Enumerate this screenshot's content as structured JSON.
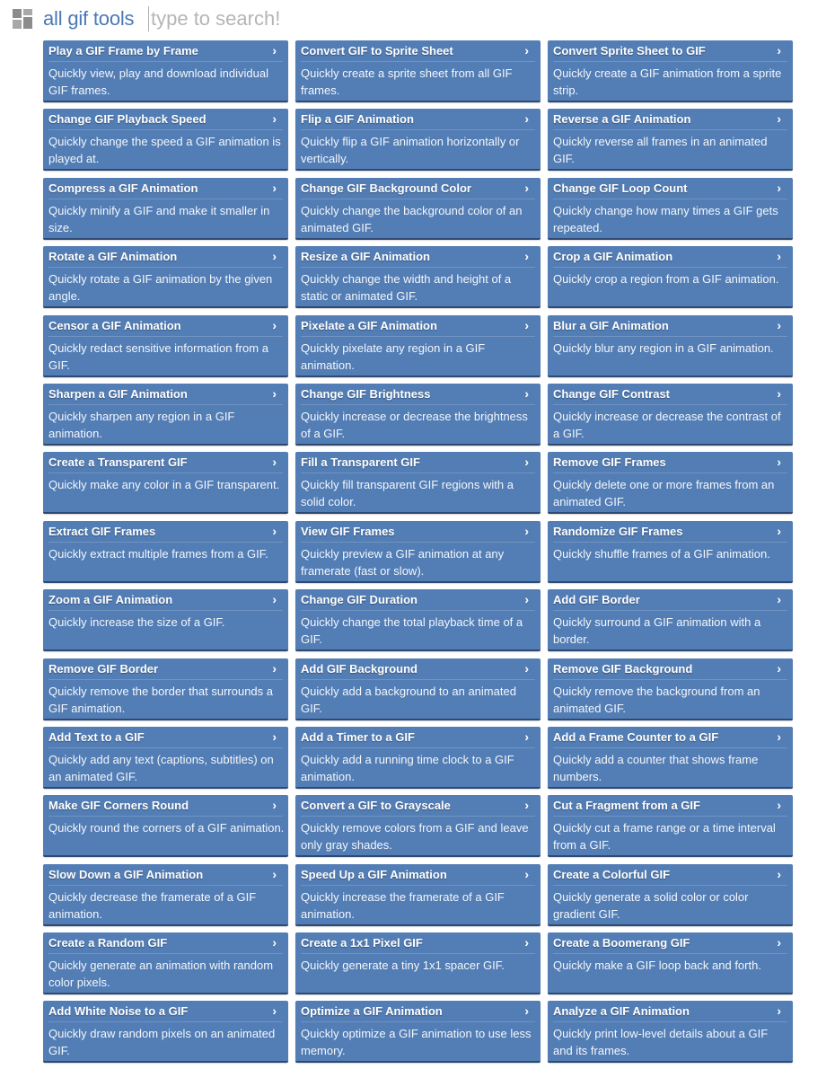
{
  "header": {
    "logo_icon": "grid-squares-icon",
    "title": "all gif tools",
    "search_placeholder": "type to search!",
    "search_value": ""
  },
  "card_icon": "chevron-right-icon",
  "tools": [
    {
      "title": "Play a GIF Frame by Frame",
      "desc": "Quickly view, play and download individual GIF frames."
    },
    {
      "title": "Convert GIF to Sprite Sheet",
      "desc": "Quickly create a sprite sheet from all GIF frames."
    },
    {
      "title": "Convert Sprite Sheet to GIF",
      "desc": "Quickly create a GIF animation from a sprite strip."
    },
    {
      "title": "Change GIF Playback Speed",
      "desc": "Quickly change the speed a GIF animation is played at."
    },
    {
      "title": "Flip a GIF Animation",
      "desc": "Quickly flip a GIF animation horizontally or vertically."
    },
    {
      "title": "Reverse a GIF Animation",
      "desc": "Quickly reverse all frames in an animated GIF."
    },
    {
      "title": "Compress a GIF Animation",
      "desc": "Quickly minify a GIF and make it smaller in size."
    },
    {
      "title": "Change GIF Background Color",
      "desc": "Quickly change the background color of an animated GIF."
    },
    {
      "title": "Change GIF Loop Count",
      "desc": "Quickly change how many times a GIF gets repeated."
    },
    {
      "title": "Rotate a GIF Animation",
      "desc": "Quickly rotate a GIF animation by the given angle."
    },
    {
      "title": "Resize a GIF Animation",
      "desc": "Quickly change the width and height of a static or animated GIF."
    },
    {
      "title": "Crop a GIF Animation",
      "desc": "Quickly crop a region from a GIF animation."
    },
    {
      "title": "Censor a GIF Animation",
      "desc": "Quickly redact sensitive information from a GIF."
    },
    {
      "title": "Pixelate a GIF Animation",
      "desc": "Quickly pixelate any region in a GIF animation."
    },
    {
      "title": "Blur a GIF Animation",
      "desc": "Quickly blur any region in a GIF animation."
    },
    {
      "title": "Sharpen a GIF Animation",
      "desc": "Quickly sharpen any region in a GIF animation."
    },
    {
      "title": "Change GIF Brightness",
      "desc": "Quickly increase or decrease the brightness of a GIF."
    },
    {
      "title": "Change GIF Contrast",
      "desc": "Quickly increase or decrease the contrast of a GIF."
    },
    {
      "title": "Create a Transparent GIF",
      "desc": "Quickly make any color in a GIF transparent."
    },
    {
      "title": "Fill a Transparent GIF",
      "desc": "Quickly fill transparent GIF regions with a solid color."
    },
    {
      "title": "Remove GIF Frames",
      "desc": "Quickly delete one or more frames from an animated GIF."
    },
    {
      "title": "Extract GIF Frames",
      "desc": "Quickly extract multiple frames from a GIF."
    },
    {
      "title": "View GIF Frames",
      "desc": "Quickly preview a GIF animation at any framerate (fast or slow)."
    },
    {
      "title": "Randomize GIF Frames",
      "desc": "Quickly shuffle frames of a GIF animation."
    },
    {
      "title": "Zoom a GIF Animation",
      "desc": "Quickly increase the size of a GIF."
    },
    {
      "title": "Change GIF Duration",
      "desc": "Quickly change the total playback time of a GIF."
    },
    {
      "title": "Add GIF Border",
      "desc": "Quickly surround a GIF animation with a border."
    },
    {
      "title": "Remove GIF Border",
      "desc": "Quickly remove the border that surrounds a GIF animation."
    },
    {
      "title": "Add GIF Background",
      "desc": "Quickly add a background to an animated GIF."
    },
    {
      "title": "Remove GIF Background",
      "desc": "Quickly remove the background from an animated GIF."
    },
    {
      "title": "Add Text to a GIF",
      "desc": "Quickly add any text (captions, subtitles) on an animated GIF."
    },
    {
      "title": "Add a Timer to a GIF",
      "desc": "Quickly add a running time clock to a GIF animation."
    },
    {
      "title": "Add a Frame Counter to a GIF",
      "desc": "Quickly add a counter that shows frame numbers."
    },
    {
      "title": "Make GIF Corners Round",
      "desc": "Quickly round the corners of a GIF animation."
    },
    {
      "title": "Convert a GIF to Grayscale",
      "desc": "Quickly remove colors from a GIF and leave only gray shades."
    },
    {
      "title": "Cut a Fragment from a GIF",
      "desc": "Quickly cut a frame range or a time interval from a GIF."
    },
    {
      "title": "Slow Down a GIF Animation",
      "desc": "Quickly decrease the framerate of a GIF animation."
    },
    {
      "title": "Speed Up a GIF Animation",
      "desc": "Quickly increase the framerate of a GIF animation."
    },
    {
      "title": "Create a Colorful GIF",
      "desc": "Quickly generate a solid color or color gradient GIF."
    },
    {
      "title": "Create a Random GIF",
      "desc": "Quickly generate an animation with random color pixels."
    },
    {
      "title": "Create a 1x1 Pixel GIF",
      "desc": "Quickly generate a tiny 1x1 spacer GIF."
    },
    {
      "title": "Create a Boomerang GIF",
      "desc": "Quickly make a GIF loop back and forth."
    },
    {
      "title": "Add White Noise to a GIF",
      "desc": "Quickly draw random pixels on an animated GIF."
    },
    {
      "title": "Optimize a GIF Animation",
      "desc": "Quickly optimize a GIF animation to use less memory."
    },
    {
      "title": "Analyze a GIF Animation",
      "desc": "Quickly print low-level details about a GIF and its frames."
    }
  ],
  "colors": {
    "card_bg": "#527db5",
    "card_border": "#2e4a73",
    "title_text": "#4a78b4",
    "placeholder_text": "#b5b5b5"
  }
}
